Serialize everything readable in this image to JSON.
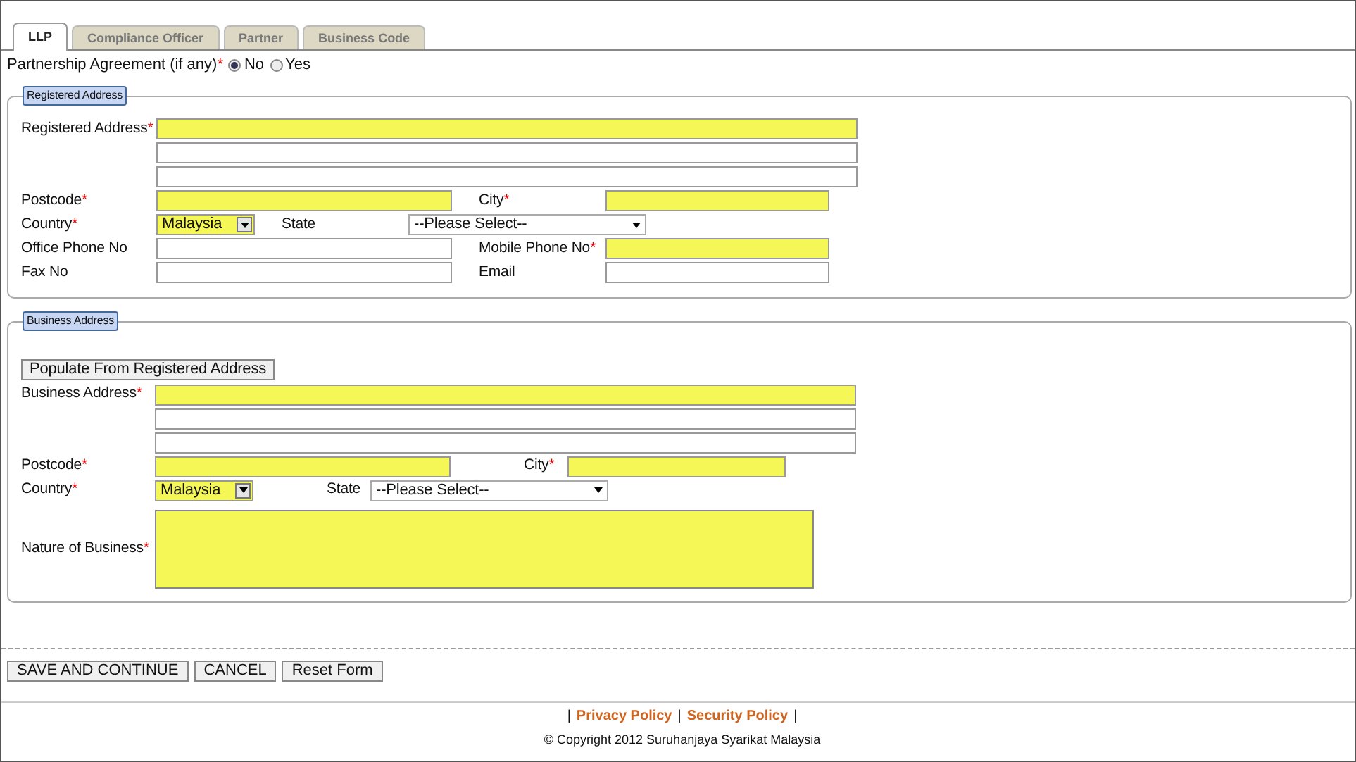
{
  "required_mark": "*",
  "tabs": [
    {
      "label": "LLP",
      "selected": true
    },
    {
      "label": "Compliance Officer",
      "selected": false
    },
    {
      "label": "Partner",
      "selected": false
    },
    {
      "label": "Business Code",
      "selected": false
    }
  ],
  "partnership_agreement": {
    "label": "Partnership Agreement (if any)",
    "required": true,
    "options": [
      {
        "label": "No",
        "selected": true
      },
      {
        "label": "Yes",
        "selected": false
      }
    ]
  },
  "registered_address": {
    "legend": "Registered Address",
    "address": {
      "label": "Registered Address",
      "required": true,
      "lines": [
        {
          "required": true
        },
        {
          "required": false
        },
        {
          "required": false
        }
      ]
    },
    "rows": [
      [
        {
          "label": "Postcode",
          "required": true,
          "kind": "text"
        },
        {
          "label": "City",
          "required": true,
          "kind": "text"
        }
      ],
      [
        {
          "label": "Country",
          "required": true,
          "kind": "combo",
          "value": "Malaysia"
        },
        {
          "label": "State",
          "required": false,
          "kind": "select",
          "value": "--Please Select--"
        }
      ],
      [
        {
          "label": "Office Phone No",
          "required": false,
          "kind": "text"
        },
        {
          "label": "Mobile Phone No",
          "required": true,
          "kind": "text"
        }
      ],
      [
        {
          "label": "Fax No",
          "required": false,
          "kind": "text"
        },
        {
          "label": "Email",
          "required": false,
          "kind": "text"
        }
      ]
    ]
  },
  "business_address": {
    "legend": "Business Address",
    "populate_button": "Populate From Registered Address",
    "address": {
      "label": "Business Address",
      "required": true,
      "lines": [
        {
          "required": true
        },
        {
          "required": false
        },
        {
          "required": false
        }
      ]
    },
    "rows": [
      [
        {
          "label": "Postcode",
          "required": true,
          "kind": "text"
        },
        {
          "label": "City",
          "required": true,
          "kind": "text"
        }
      ],
      [
        {
          "label": "Country",
          "required": true,
          "kind": "combo",
          "value": "Malaysia"
        },
        {
          "label": "State",
          "required": false,
          "kind": "select",
          "value": "--Please Select--"
        }
      ]
    ],
    "nature_of_business": {
      "label": "Nature of Business",
      "required": true
    }
  },
  "buttons": [
    "SAVE AND CONTINUE",
    "CANCEL",
    "Reset Form"
  ],
  "footer": {
    "items": [
      {
        "kind": "separator",
        "text": "|"
      },
      {
        "kind": "link",
        "text": "Privacy Policy"
      },
      {
        "kind": "separator",
        "text": "|"
      },
      {
        "kind": "link",
        "text": "Security Policy"
      },
      {
        "kind": "separator",
        "text": "|"
      }
    ],
    "copyright": "© Copyright 2012 Suruhanjaya Syarikat Malaysia"
  }
}
